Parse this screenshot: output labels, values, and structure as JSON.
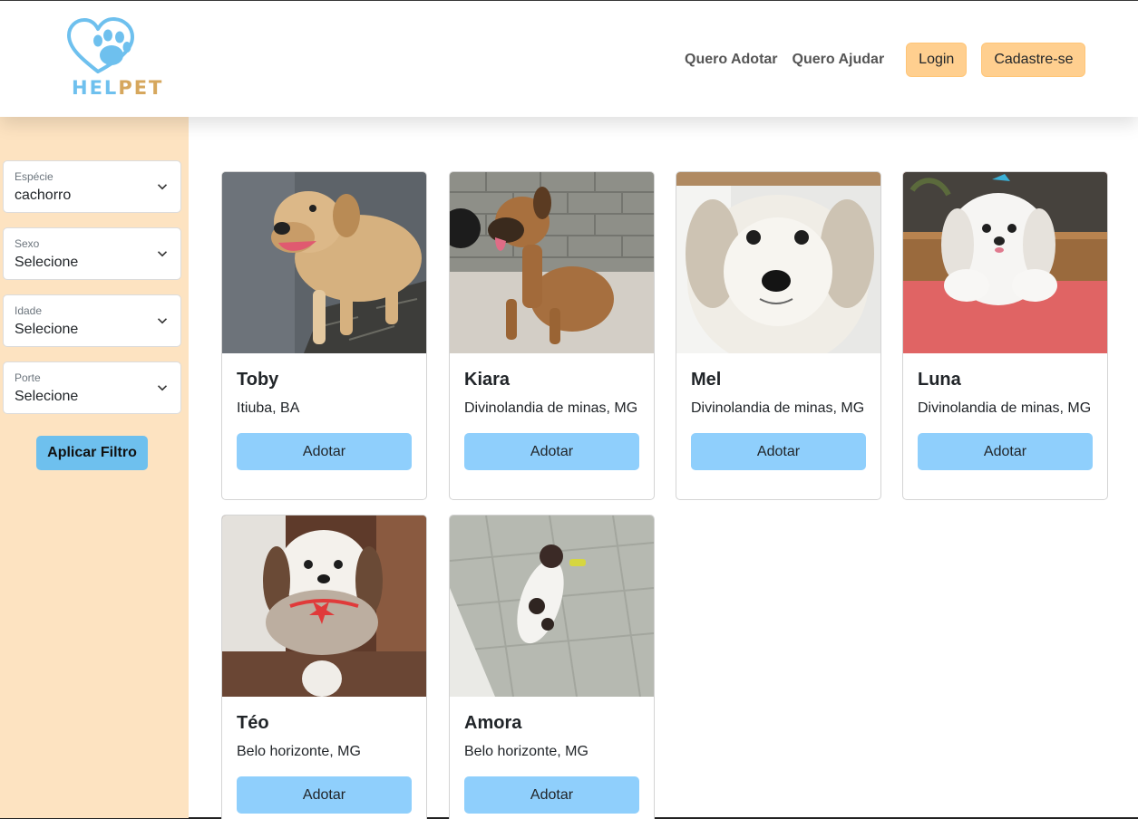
{
  "brand": {
    "logo_part1": "HEL",
    "logo_part2": "PET"
  },
  "nav": {
    "links": [
      "Quero Adotar",
      "Quero Ajudar"
    ],
    "login_label": "Login",
    "signup_label": "Cadastre-se"
  },
  "filters": {
    "items": [
      {
        "label": "Espécie",
        "value": "cachorro"
      },
      {
        "label": "Sexo",
        "value": "Selecione"
      },
      {
        "label": "Idade",
        "value": "Selecione"
      },
      {
        "label": "Porte",
        "value": "Selecione"
      }
    ],
    "apply_label": "Aplicar Filtro"
  },
  "pets": [
    {
      "name": "Toby",
      "location": "Itiuba, BA",
      "button": "Adotar"
    },
    {
      "name": "Kiara",
      "location": "Divinolandia de minas, MG",
      "button": "Adotar"
    },
    {
      "name": "Mel",
      "location": "Divinolandia de minas, MG",
      "button": "Adotar"
    },
    {
      "name": "Luna",
      "location": "Divinolandia de minas, MG",
      "button": "Adotar"
    },
    {
      "name": "Téo",
      "location": "Belo horizonte, MG",
      "button": "Adotar"
    },
    {
      "name": "Amora",
      "location": "Belo horizonte, MG",
      "button": "Adotar"
    }
  ],
  "colors": {
    "sidebar_bg": "#fde3c1",
    "peach_button": "#ffcf8f",
    "adopt_button": "#8fcffc",
    "apply_button": "#6ec0ee",
    "logo_blue": "#6ec0ee",
    "logo_gold": "#d6a75d"
  }
}
